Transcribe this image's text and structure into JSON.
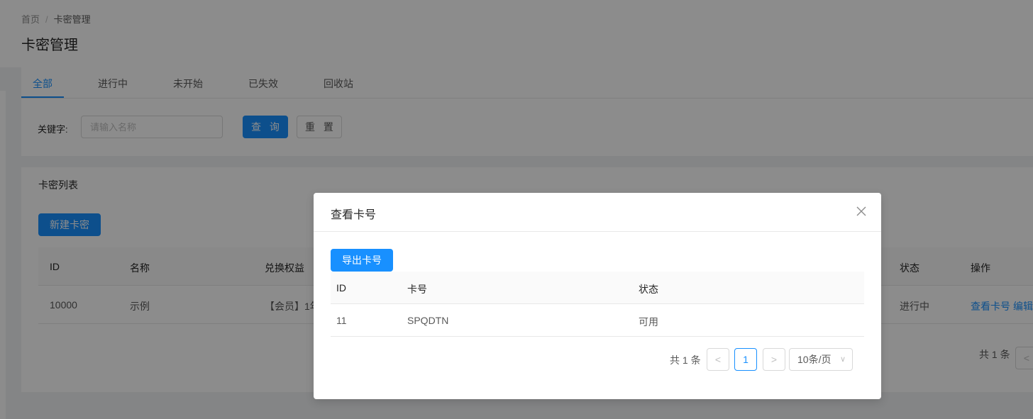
{
  "breadcrumb": {
    "home": "首页",
    "separator": "/",
    "current": "卡密管理"
  },
  "page_title": "卡密管理",
  "tabs": [
    {
      "label": "全部",
      "active": true
    },
    {
      "label": "进行中",
      "active": false
    },
    {
      "label": "未开始",
      "active": false
    },
    {
      "label": "已失效",
      "active": false
    },
    {
      "label": "回收站",
      "active": false
    }
  ],
  "filter": {
    "label": "关键字:",
    "placeholder": "请输入名称",
    "value": "",
    "query_label": "查 询",
    "reset_label": "重 置"
  },
  "list": {
    "title": "卡密列表",
    "new_button": "新建卡密",
    "columns": {
      "id": "ID",
      "name": "名称",
      "benefit": "兑换权益",
      "status": "状态",
      "actions": "操作"
    },
    "rows": [
      {
        "id": "10000",
        "name": "示例",
        "benefit": "【会员】1年",
        "status": "进行中",
        "action_view": "查看卡号",
        "action_edit": "编辑"
      }
    ],
    "pager_total": "共 1 条",
    "pager_prev": "<"
  },
  "modal": {
    "title": "查看卡号",
    "close_icon": "close-icon",
    "export_button": "导出卡号",
    "columns": {
      "id": "ID",
      "card_no": "卡号",
      "status": "状态"
    },
    "rows": [
      {
        "id": "11",
        "card_no": "SPQDTN",
        "status": "可用"
      }
    ],
    "pagination": {
      "total": "共 1 条",
      "prev": "<",
      "current_page": "1",
      "next": ">",
      "page_size": "10条/页"
    }
  },
  "colors": {
    "primary": "#1890ff",
    "mask": "rgba(0,0,0,0.45)"
  }
}
